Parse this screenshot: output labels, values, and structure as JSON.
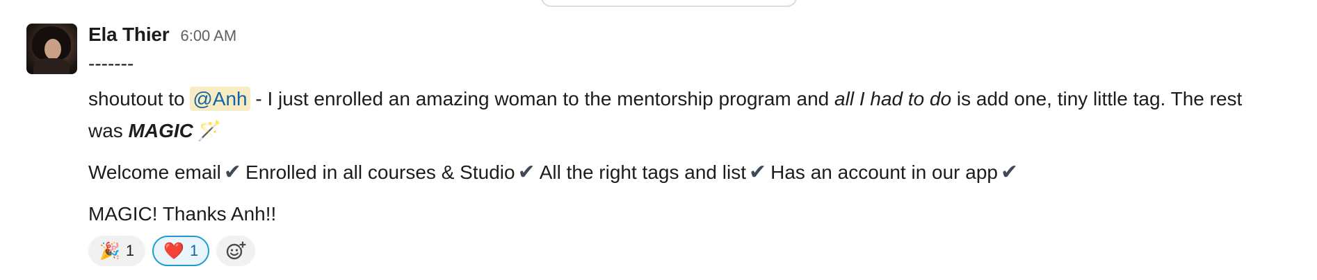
{
  "message": {
    "author": "Ela Thier",
    "timestamp": "6:00 AM",
    "divider": "-------",
    "paragraph1": {
      "prefix": "shoutout to ",
      "mention": "@Anh",
      "middle": " - I just enrolled an amazing woman to the mentorship program and ",
      "italic": "all I had to do",
      "suffix": " is add one, tiny little tag. The rest",
      "line2_prefix": "was ",
      "bold_italic": "MAGIC",
      "wand_emoji": "🪄"
    },
    "checklist": {
      "item1": "Welcome email",
      "item2": "Enrolled in all courses & Studio",
      "item3": "All the right tags and list",
      "item4": "Has an account in our app",
      "check_glyph": "✔"
    },
    "closing": "MAGIC! Thanks Anh!!"
  },
  "reactions": [
    {
      "emoji": "🎉",
      "count": "1",
      "active": false
    },
    {
      "emoji": "❤️",
      "count": "1",
      "active": true
    }
  ],
  "add_reaction_icon": "add-emoji-icon",
  "colors": {
    "mention_bg": "#f8ecc4",
    "mention_text": "#1264a3",
    "active_reaction_border": "#1d9bd1"
  }
}
